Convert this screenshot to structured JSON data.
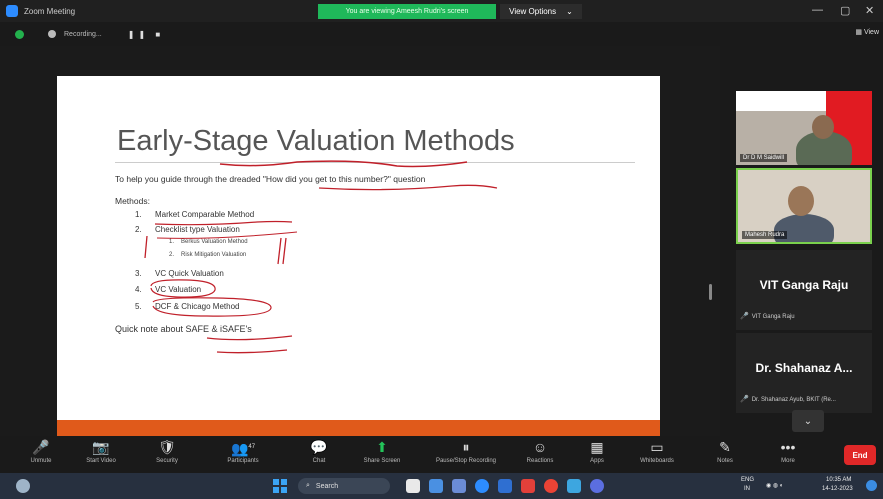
{
  "window": {
    "title": "Zoom Meeting"
  },
  "banner": {
    "sharing_text": "You are viewing Ameesh Rudri's screen",
    "view_options": "View Options",
    "view_chevron": "⌄"
  },
  "recording": {
    "label": "Recording...",
    "controls": "❚❚ ■",
    "view": "View"
  },
  "slide": {
    "title": "Early-Stage Valuation Methods",
    "subtitle": "To help you guide through the dreaded \"How did you get to this number?\" question",
    "methods_heading": "Methods:",
    "items": [
      {
        "num": "1.",
        "text": "Market Comparable Method"
      },
      {
        "num": "2.",
        "text": "Checklist type Valuation"
      },
      {
        "num": "3.",
        "text": "VC Quick Valuation"
      },
      {
        "num": "4.",
        "text": "VC Valuation"
      },
      {
        "num": "5.",
        "text": "DCF & Chicago Method"
      }
    ],
    "sub_items": [
      {
        "num": "1.",
        "text": "Berkus Valuation Method"
      },
      {
        "num": "2.",
        "text": "Risk Mitigation Valuation"
      }
    ],
    "note": "Quick note about SAFE & iSAFE's",
    "accent_color": "#e05a1b"
  },
  "participants": [
    {
      "name": "Dr D M Saidwill"
    },
    {
      "name": "Mahesh Rudra"
    },
    {
      "display": "VIT Ganga Raju",
      "name": "VIT Ganga Raju"
    },
    {
      "display": "Dr. Shahanaz A...",
      "name": "Dr. Shahanaz Ayub, BKIT (Re..."
    }
  ],
  "toolbar": {
    "items": [
      {
        "label": "Unmute",
        "icon": "🎤"
      },
      {
        "label": "Start Video",
        "icon": "📷"
      },
      {
        "label": "Security",
        "icon": "🛡"
      },
      {
        "label": "Participants",
        "icon": "👥",
        "count": "47"
      },
      {
        "label": "Chat",
        "icon": "💬"
      },
      {
        "label": "Share Screen",
        "icon": "⬆"
      },
      {
        "label": "Pause/Stop Recording",
        "icon": "⏸"
      },
      {
        "label": "Reactions",
        "icon": "☺"
      },
      {
        "label": "Apps",
        "icon": "▦"
      },
      {
        "label": "Whiteboards",
        "icon": "▭"
      },
      {
        "label": "Notes",
        "icon": "✎"
      },
      {
        "label": "More",
        "icon": "•••"
      }
    ],
    "end_label": "End"
  },
  "taskbar": {
    "search": "Search",
    "lang_line1": "ENG",
    "lang_line2": "IN",
    "time": "10:35 AM",
    "date": "14-12-2023"
  }
}
